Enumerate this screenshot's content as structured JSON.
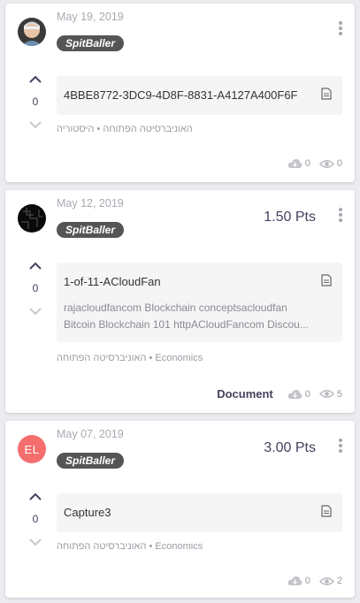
{
  "posts": [
    {
      "date": "May 19, 2019",
      "badge": "SpitBaller",
      "votes": "0",
      "doc_title": "4BBE8772-3DC9-4D8F-8831-A4127A400F6F",
      "university": "האוניברסיטה הפתוחה",
      "course": "היסטוריה",
      "downloads": "0",
      "views": "0",
      "avatar_icon": "user-photo-icon"
    },
    {
      "date": "May 12, 2019",
      "badge": "SpitBaller",
      "points": "1.50 Pts",
      "votes": "0",
      "doc_title": "1-of-11-ACloudFan",
      "doc_desc_line1": "rajacloudfancom Blockchain conceptsacloudfan",
      "doc_desc_line2": "Bitcoin Blockchain 101 httpACloudFancom Discou...",
      "university": "האוניברסיטה הפתוחה",
      "course": "Economics",
      "doc_type": "Document",
      "downloads": "0",
      "views": "5",
      "avatar_icon": "dark-pattern-avatar-icon"
    },
    {
      "date": "May 07, 2019",
      "badge": "SpitBaller",
      "points": "3.00 Pts",
      "avatar_initials": "EL",
      "votes": "0",
      "doc_title": "Capture3",
      "university": "האוניברסיטה הפתוחה",
      "course": "Economics",
      "downloads": "0",
      "views": "2"
    }
  ],
  "colors": {
    "accent": "#43425d",
    "badge": "#555555",
    "initials_avatar": "#f56e6e",
    "muted": "#9b9ba5"
  }
}
